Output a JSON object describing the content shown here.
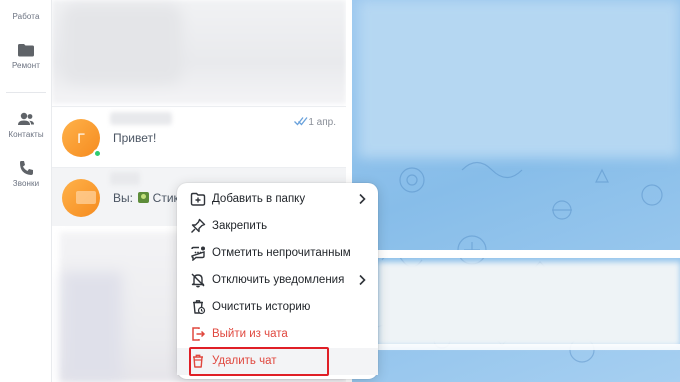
{
  "sidebar": {
    "items": [
      {
        "label": "Работа",
        "icon": "folder-icon"
      },
      {
        "label": "Ремонт",
        "icon": "folder-icon"
      },
      {
        "label": "Контакты",
        "icon": "contacts-icon"
      },
      {
        "label": "Звонки",
        "icon": "phone-icon"
      }
    ]
  },
  "chats": [
    {
      "avatar_letter": "Г",
      "message": "Привет!",
      "date": "1 апр.",
      "online": true,
      "read": true
    },
    {
      "message_prefix": "Вы:",
      "message_text": "Стик"
    }
  ],
  "context_menu": {
    "items": [
      {
        "label": "Добавить в папку",
        "icon": "folder-add-icon",
        "has_submenu": true
      },
      {
        "label": "Закрепить",
        "icon": "pin-icon"
      },
      {
        "label": "Отметить непрочитанным",
        "icon": "mark-unread-icon"
      },
      {
        "label": "Отключить уведомления",
        "icon": "bell-off-icon",
        "has_submenu": true
      },
      {
        "label": "Очистить историю",
        "icon": "clear-history-icon"
      },
      {
        "label": "Выйти из чата",
        "icon": "exit-icon",
        "danger": true
      },
      {
        "label": "Удалить чат",
        "icon": "trash-icon",
        "danger": true,
        "highlighted": true
      }
    ]
  },
  "colors": {
    "accent": "#e0483f",
    "highlight_border": "#e01f26",
    "avatar": "#f7941d",
    "online": "#2ecc71",
    "chat_background": "#8cc0ea"
  }
}
